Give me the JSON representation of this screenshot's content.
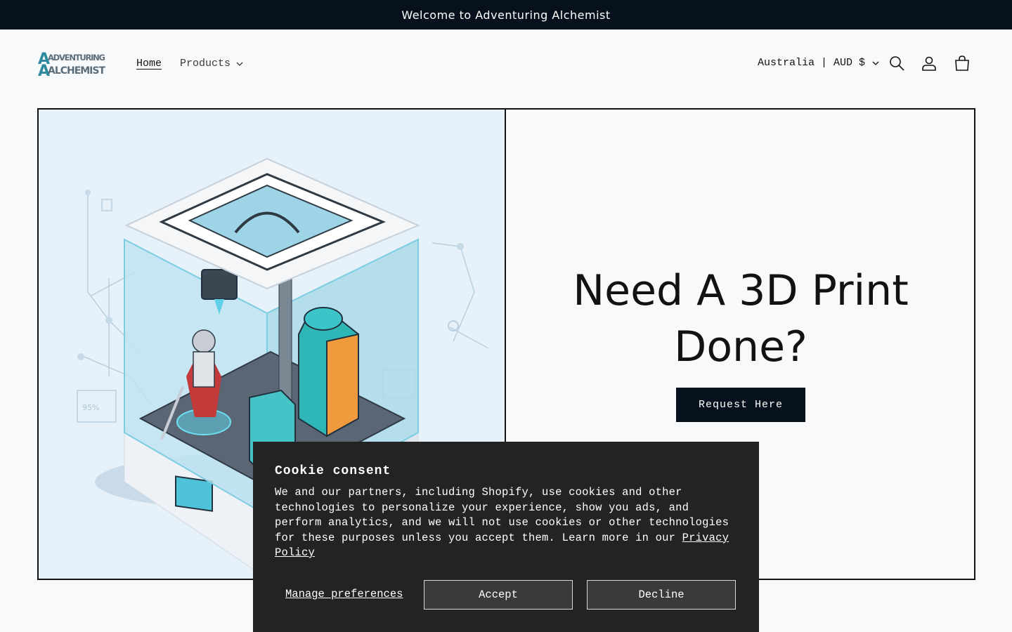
{
  "announcement": {
    "text": "Welcome to Adventuring Alchemist"
  },
  "header": {
    "logo_top": "ADVENTURING",
    "logo_bottom": "ALCHEMIST",
    "nav": {
      "home": "Home",
      "products": "Products"
    },
    "locale": "Australia | AUD $"
  },
  "hero": {
    "title": "Need A 3D Print Done?",
    "button": "Request Here"
  },
  "cookie": {
    "title": "Cookie consent",
    "body": "We and our partners, including Shopify, use cookies and other technologies to personalize your experience, show you ads, and perform analytics, and we will not use cookies or other technologies for these purposes unless you accept them. Learn more in our ",
    "privacy_link": "Privacy Policy",
    "manage": "Manage preferences",
    "accept": "Accept",
    "decline": "Decline"
  },
  "colors": {
    "dark": "#07111d",
    "accent": "#2ab3c8",
    "cookie_bg": "#232323"
  }
}
